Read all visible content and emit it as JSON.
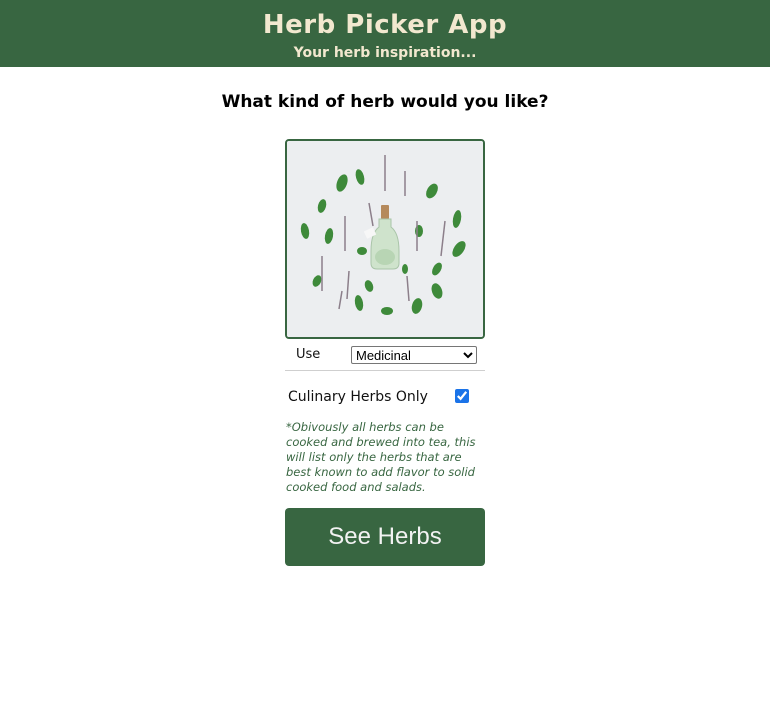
{
  "header": {
    "title": "Herb Picker App",
    "subtitle": "Your herb inspiration..."
  },
  "main": {
    "question": "What kind of herb would you like?",
    "use": {
      "label": "Use",
      "selected": "Medicinal",
      "options": [
        "Medicinal"
      ]
    },
    "culinary": {
      "label": "Culinary Herbs Only",
      "checked": true
    },
    "note": "*Obivously all herbs can be cooked and brewed into tea, this will list only the herbs that are best known to add flavor to solid cooked food and salads.",
    "button_label": "See Herbs"
  },
  "colors": {
    "brand_green": "#386641",
    "header_text": "#f2e8cf",
    "checkbox_accent": "#1a73e8"
  }
}
